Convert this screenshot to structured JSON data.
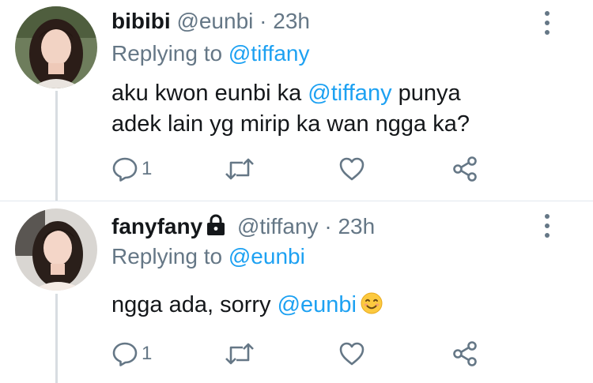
{
  "tweets": [
    {
      "name": "bibibi",
      "handle": "@eunbi",
      "separator": "·",
      "time": "23h",
      "reply_prefix": "Replying to",
      "reply_to": "@tiffany",
      "text_line1_before": "aku kwon eunbi ka ",
      "text_line1_mention": "@tiffany",
      "text_line1_after": " punya",
      "text_line2": "adek lain yg mirip ka wan ngga ka?",
      "reply_count": "1",
      "protected": false
    },
    {
      "name": "fanyfany",
      "handle": "@tiffany",
      "separator": "·",
      "time": "23h",
      "reply_prefix": "Replying to",
      "reply_to": "@eunbi",
      "text_before": "ngga ada, sorry ",
      "text_mention": "@eunbi",
      "reply_count": "1",
      "protected": true
    }
  ],
  "icons": {
    "more": "more-vertical-icon",
    "reply": "reply-bubble-icon",
    "retweet": "retweet-icon",
    "like": "heart-icon",
    "share": "share-icon",
    "lock": "lock-icon",
    "emoji": "smiling-face-emoji"
  },
  "colors": {
    "text": "#14171a",
    "secondary": "#657786",
    "mention": "#1da1f2",
    "thread_line": "#d8dde1"
  }
}
